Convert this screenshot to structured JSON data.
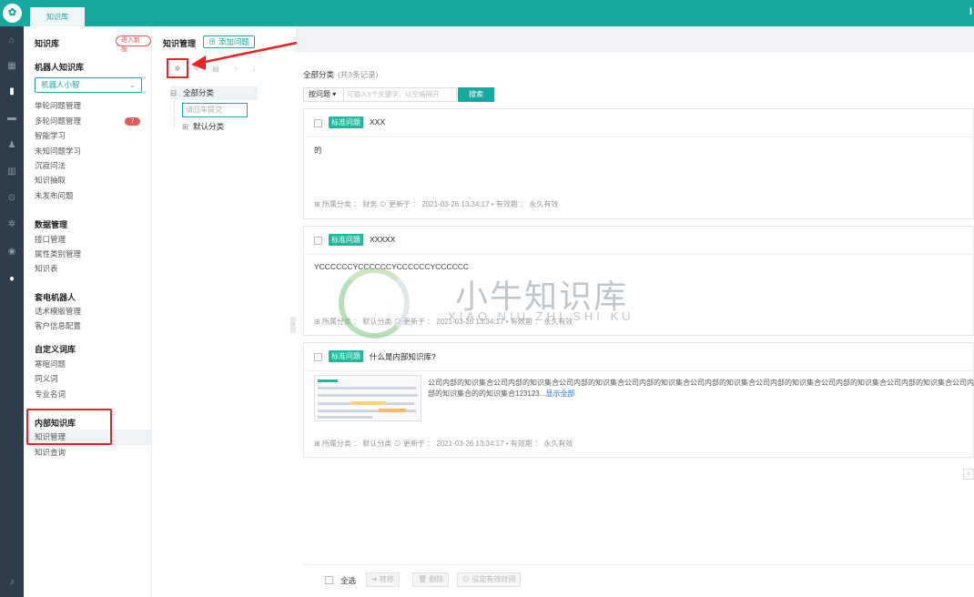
{
  "topbar": {
    "logo_glyph": "✿",
    "tab": "知识库",
    "user_initial": "I",
    "brand_color": "#17a8a0"
  },
  "rail_icons": [
    "home-icon",
    "grid-icon",
    "document-icon",
    "chat-icon",
    "users-icon",
    "chart-icon",
    "search-icon",
    "gear-icon",
    "settings-icon",
    "user-circle-icon",
    "bell-icon"
  ],
  "sidebar": {
    "title": "知识库",
    "enter_new": "进入新版",
    "robot_section": "机器人知识库",
    "robot_select": "机器人小智",
    "robot_items": [
      "单轮问题管理",
      "多轮问题管理",
      "智能学习",
      "未知问题学习",
      "沉寂问法",
      "知识抽取",
      "未发布问题"
    ],
    "multi_badge": "7",
    "data_section": "数据管理",
    "data_items": [
      "接口管理",
      "属性类别管理",
      "知识表"
    ],
    "phone_section": "套电机器人",
    "phone_items": [
      "话术模版管理",
      "客户信息配置"
    ],
    "custom_section": "自定义词库",
    "custom_items": [
      "寒暄问题",
      "同义词",
      "专业名词"
    ],
    "internal_section": "内部知识库",
    "internal_items": [
      "知识管理",
      "知识查询"
    ]
  },
  "mid": {
    "breadcrumb": "知识管理",
    "add_button": "添加问题",
    "tree_root": "全部分类",
    "tree_input_placeholder": "请回车提交",
    "tree_child": "默认分类"
  },
  "main": {
    "summary_title": "全部分类",
    "summary_count": "(共3条记录)",
    "filter_type": "按问题 ▾",
    "keyword_placeholder": "可输入5个关键字，以空格隔开",
    "search_button": "搜索",
    "cards": [
      {
        "tag": "标准问题",
        "title": "XXX",
        "answer": "的",
        "meta": "⊞ 所属分类 ： 财务  ⊙ 更新于 ： 2021-03-26 13:34:17  •  有效期 ： 永久有效"
      },
      {
        "tag": "标准问题",
        "title": "XXXXX",
        "answer": "YCCCCCCYCCCCCCYCCCCCCYCCCCCC",
        "meta": "⊞ 所属分类 ： 默认分类  ⊙ 更新于 ： 2021-03-26 13:34:17  •  有效期 ： 永久有效"
      },
      {
        "tag": "标准问题",
        "title": "什么是内部知识库?",
        "rich": "公司内部的知识集合公司内部的知识集合公司内部的知识集合公司内部的知识集合公司内部的知识集合公司内部的知识集合公司内部的知识集合公司内部的知识集合公司内部的知识集合的的知识集合123123...",
        "more": "显示全部",
        "meta": "⊞ 所属分类 ： 默认分类  ⊙ 更新于 ： 2021-03-26 13:34:17  •  有效期 ： 永久有效"
      }
    ],
    "bottom": {
      "select_all": "全选",
      "move": "➜ 转移",
      "delete": "🗑 删除",
      "set_valid": "⊙ 设定有效时间"
    }
  },
  "watermark": {
    "cn": "小牛知识库",
    "pinyin": "XIAO NIU ZHI SHI KU"
  }
}
